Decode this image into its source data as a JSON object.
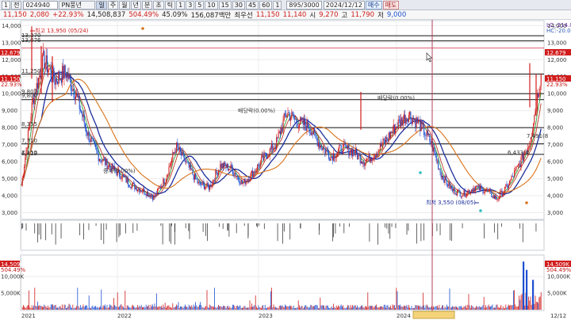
{
  "toolbar": {
    "market_code": "1",
    "market_label": "전",
    "stock_code": "024940",
    "stock_name": "PN풍년",
    "period_buttons": [
      "주",
      "월",
      "년",
      "분",
      "초",
      "틱"
    ],
    "interval_buttons": [
      "1",
      "3",
      "5",
      "10",
      "15",
      "30",
      "45",
      "60",
      "1"
    ],
    "count": "895/3000",
    "date": "2024/12/12",
    "buy_label": "매수",
    "sell_label": "매도"
  },
  "info": {
    "price": "11,150",
    "change": "2,080",
    "change_rate": "+22.93%",
    "volume": "14,508,837",
    "volume_rate": "504.49%",
    "turnover": "45.09%",
    "amount": "156,087백만",
    "best_label": "최우선",
    "bid": "11,150",
    "ask": "11,140",
    "open_label": "시",
    "open": "9,270",
    "high_label": "고",
    "high": "11,790",
    "low_label": "저",
    "low": "9,000"
  },
  "chart_data": {
    "type": "candlestick",
    "x_tick_labels": [
      "2021",
      "2022",
      "2023",
      "2024",
      "12/12"
    ],
    "y_tick_labels": [
      "3,000",
      "4,000",
      "5,000",
      "6,000",
      "7,000",
      "8,000",
      "9,000",
      "10,000",
      "11,000",
      "12,000",
      "13,000",
      "14,000"
    ],
    "ylim": [
      2700,
      14200
    ],
    "close_series": [
      {
        "date": "2021-01",
        "close": 4600
      },
      {
        "date": "2021-02",
        "close": 9500
      },
      {
        "date": "2021-03",
        "close": 12000
      },
      {
        "date": "2021-04",
        "close": 10800
      },
      {
        "date": "2021-05",
        "close": 11300
      },
      {
        "date": "2021-06",
        "close": 9800
      },
      {
        "date": "2021-07",
        "close": 7600
      },
      {
        "date": "2021-08",
        "close": 6300
      },
      {
        "date": "2021-09",
        "close": 5700
      },
      {
        "date": "2021-10",
        "close": 5200
      },
      {
        "date": "2021-11",
        "close": 4600
      },
      {
        "date": "2021-12",
        "close": 4300
      },
      {
        "date": "2022-01",
        "close": 3900
      },
      {
        "date": "2022-02",
        "close": 5000
      },
      {
        "date": "2022-03",
        "close": 6900
      },
      {
        "date": "2022-04",
        "close": 5800
      },
      {
        "date": "2022-05",
        "close": 4700
      },
      {
        "date": "2022-06",
        "close": 4500
      },
      {
        "date": "2022-07",
        "close": 5800
      },
      {
        "date": "2022-08",
        "close": 5600
      },
      {
        "date": "2022-09",
        "close": 4700
      },
      {
        "date": "2022-10",
        "close": 5400
      },
      {
        "date": "2022-11",
        "close": 6300
      },
      {
        "date": "2022-12",
        "close": 7000
      },
      {
        "date": "2023-01",
        "close": 8900
      },
      {
        "date": "2023-02",
        "close": 8300
      },
      {
        "date": "2023-03",
        "close": 8100
      },
      {
        "date": "2023-04",
        "close": 7000
      },
      {
        "date": "2023-05",
        "close": 6300
      },
      {
        "date": "2023-06",
        "close": 6800
      },
      {
        "date": "2023-07",
        "close": 6600
      },
      {
        "date": "2023-08",
        "close": 6000
      },
      {
        "date": "2023-09",
        "close": 6500
      },
      {
        "date": "2023-10",
        "close": 7300
      },
      {
        "date": "2023-11",
        "close": 8200
      },
      {
        "date": "2023-12",
        "close": 8800
      },
      {
        "date": "2024-01",
        "close": 8200
      },
      {
        "date": "2024-02",
        "close": 7200
      },
      {
        "date": "2024-03",
        "close": 5200
      },
      {
        "date": "2024-04",
        "close": 4300
      },
      {
        "date": "2024-05",
        "close": 4100
      },
      {
        "date": "2024-06",
        "close": 4500
      },
      {
        "date": "2024-07",
        "close": 4300
      },
      {
        "date": "2024-08",
        "close": 3800
      },
      {
        "date": "2024-09",
        "close": 4600
      },
      {
        "date": "2024-10",
        "close": 5800
      },
      {
        "date": "2024-11",
        "close": 7200
      },
      {
        "date": "2024-12",
        "close": 11150
      }
    ],
    "volume_tick_labels": [
      "5,000K",
      "10,000K"
    ],
    "volume_ylim": [
      0,
      16000
    ],
    "horizontal_lines": [
      13400,
      13100,
      12679,
      11150,
      10000,
      9650,
      8000,
      7050,
      6430
    ],
    "annotations": {
      "high_label": "최고 13,950 (05/24)",
      "low_label": "최저 3,550 (08/05)",
      "small_labels": [
        "13,370",
        "13,076",
        "11,250",
        "9,802",
        "9,800",
        "8,355",
        "7,710",
        "7,110",
        "6,423",
        "배당락(0.00%)",
        "배당락(0.00%)",
        "증자(0.00%)",
        "7,491(8",
        "6,433(4"
      ]
    },
    "right_tags": {
      "lc": "LC:-214.0",
      "hc": "HC:-20.0",
      "red_level": "12,679",
      "price": "11,150",
      "pct": "22.93%",
      "vol": "14,509K",
      "vol_pct": "504.49%"
    },
    "left_tags": {
      "red_level": "12,679",
      "price": "11,150",
      "pct": "22.93%",
      "vol": "14,509K",
      "vol_pct": "504.49%"
    },
    "colors": {
      "up": "#d11c1c",
      "down": "#1d4fd1",
      "ma_short": "#c0392b",
      "ma_mid": "#1d2f9c",
      "ma_long": "#d9731a",
      "ma_green": "#2e9e3a"
    }
  }
}
